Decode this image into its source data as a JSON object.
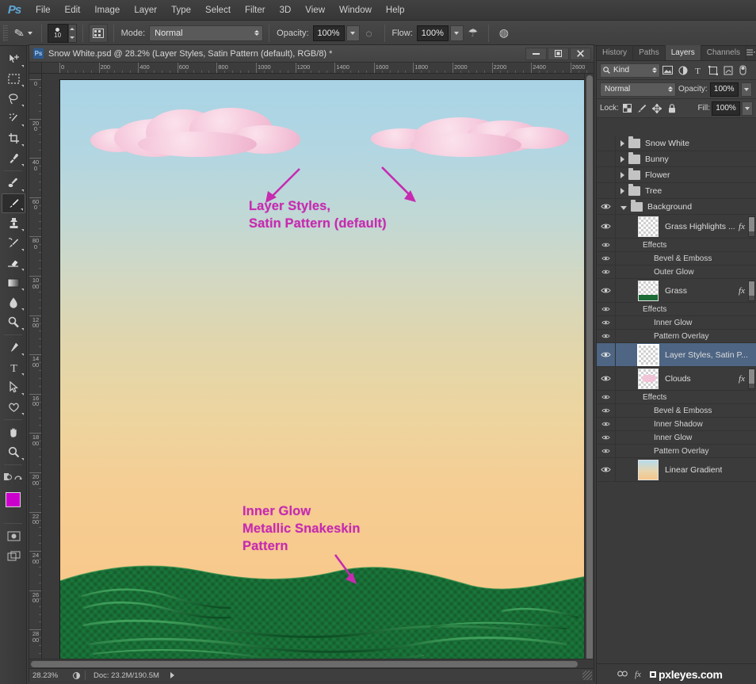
{
  "app": {
    "logo": "Ps"
  },
  "menubar": {
    "items": [
      "File",
      "Edit",
      "Image",
      "Layer",
      "Type",
      "Select",
      "Filter",
      "3D",
      "View",
      "Window",
      "Help"
    ]
  },
  "options_bar": {
    "brush_size": "10",
    "mode_label": "Mode:",
    "mode_value": "Normal",
    "opacity_label": "Opacity:",
    "opacity_value": "100%",
    "flow_label": "Flow:",
    "flow_value": "100%"
  },
  "toolbar": {
    "tools": [
      {
        "name": "move-tool",
        "glyph": "move"
      },
      {
        "name": "marquee-tool",
        "glyph": "marquee"
      },
      {
        "name": "lasso-tool",
        "glyph": "lasso"
      },
      {
        "name": "magic-wand-tool",
        "glyph": "wand"
      },
      {
        "name": "crop-tool",
        "glyph": "crop"
      },
      {
        "name": "eyedropper-tool",
        "glyph": "eyedropper"
      },
      {
        "name": "healing-brush-tool",
        "glyph": "healing"
      },
      {
        "name": "brush-tool",
        "glyph": "brush",
        "active": true
      },
      {
        "name": "clone-stamp-tool",
        "glyph": "stamp"
      },
      {
        "name": "history-brush-tool",
        "glyph": "historybrush"
      },
      {
        "name": "eraser-tool",
        "glyph": "eraser"
      },
      {
        "name": "gradient-tool",
        "glyph": "gradient"
      },
      {
        "name": "blur-tool",
        "glyph": "blur"
      },
      {
        "name": "dodge-tool",
        "glyph": "dodge"
      },
      {
        "name": "pen-tool",
        "glyph": "pen"
      },
      {
        "name": "type-tool",
        "glyph": "type"
      },
      {
        "name": "path-selection-tool",
        "glyph": "pathselect"
      },
      {
        "name": "shape-tool",
        "glyph": "shape"
      },
      {
        "name": "hand-tool",
        "glyph": "hand"
      },
      {
        "name": "zoom-tool",
        "glyph": "zoom"
      }
    ],
    "foreground_color": "#cc00cc",
    "background_color": "#ffffff"
  },
  "document": {
    "title": "Snow White.psd @ 28.2% (Layer Styles, Satin Pattern (default), RGB/8) *",
    "window_buttons": [
      "minimize",
      "restore",
      "close"
    ],
    "ruler_h_labels": [
      "0",
      "200",
      "400",
      "600",
      "800",
      "1000",
      "1200",
      "1400",
      "1600",
      "1800",
      "2000",
      "2200",
      "2400",
      "2600"
    ],
    "ruler_v_labels": [
      "0",
      "200",
      "400",
      "600",
      "800",
      "1000",
      "1200",
      "1400",
      "1600",
      "1800",
      "2000",
      "2200",
      "2400",
      "2600",
      "2800"
    ],
    "status": {
      "zoom": "28.23%",
      "doc_size": "Doc: 23.2M/190.5M"
    }
  },
  "canvas": {
    "annotations": [
      {
        "name": "annotation-layer-styles",
        "text": "Layer Styles,\nSatin Pattern (default)",
        "color": "#c62bb0"
      },
      {
        "name": "annotation-inner-glow",
        "text": "Inner Glow\nMetallic Snakeskin\nPattern",
        "color": "#c62bb0"
      }
    ],
    "sky_top_color": "#a9d4e6",
    "sky_bottom_color": "#f9c88b",
    "cloud_color": "#f2c2d8",
    "grass_color": "#1a6b35"
  },
  "panels": {
    "tabs": [
      {
        "label": "History",
        "active": false
      },
      {
        "label": "Paths",
        "active": false
      },
      {
        "label": "Layers",
        "active": true
      },
      {
        "label": "Channels",
        "active": false
      }
    ],
    "filter": {
      "kind_label": "Kind"
    },
    "blend": {
      "mode": "Normal",
      "opacity_label": "Opacity:",
      "opacity_value": "100%",
      "lock_label": "Lock:",
      "fill_label": "Fill:",
      "fill_value": "100%"
    },
    "layers": [
      {
        "type": "group",
        "name": "Snow White",
        "visible": false,
        "expanded": false
      },
      {
        "type": "group",
        "name": "Bunny",
        "visible": false,
        "expanded": false
      },
      {
        "type": "group",
        "name": "Flower",
        "visible": false,
        "expanded": false
      },
      {
        "type": "group",
        "name": "Tree",
        "visible": false,
        "expanded": false
      },
      {
        "type": "group",
        "name": "Background",
        "visible": true,
        "expanded": true
      },
      {
        "type": "layer",
        "name": "Grass Highlights ...",
        "visible": true,
        "fx": true,
        "thumb": "transparent",
        "effects": {
          "label": "Effects",
          "items": [
            "Bevel & Emboss",
            "Outer Glow"
          ]
        }
      },
      {
        "type": "layer",
        "name": "Grass",
        "visible": true,
        "fx": true,
        "thumb": "grass",
        "effects": {
          "label": "Effects",
          "items": [
            "Inner Glow",
            "Pattern Overlay"
          ]
        }
      },
      {
        "type": "layer",
        "name": "Layer Styles, Satin P...",
        "visible": true,
        "fx": false,
        "selected": true,
        "thumb": "transparent"
      },
      {
        "type": "layer",
        "name": "Clouds",
        "visible": true,
        "fx": true,
        "thumb": "clouds",
        "effects": {
          "label": "Effects",
          "items": [
            "Bevel & Emboss",
            "Inner Shadow",
            "Inner Glow",
            "Pattern Overlay"
          ]
        }
      },
      {
        "type": "layer",
        "name": "Linear Gradient",
        "visible": true,
        "fx": false,
        "thumb": "gradient"
      }
    ],
    "footer": {
      "watermark": "pxleyes.com"
    }
  }
}
